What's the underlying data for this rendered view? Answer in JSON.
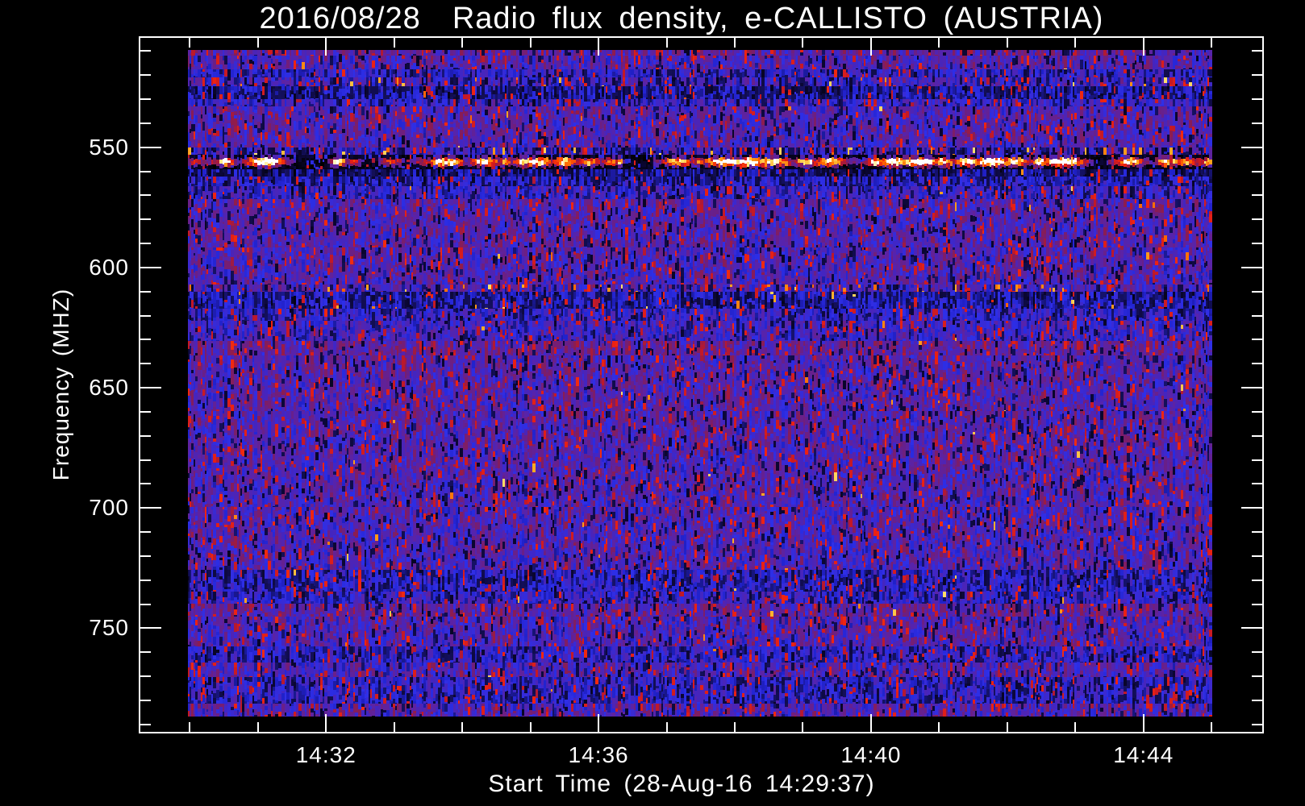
{
  "figure": {
    "title": "2016/08/28  Radio flux density, e-CALLISTO (AUSTRIA)",
    "x_axis_title": "Start Time (28-Aug-16 14:29:37)",
    "y_axis_title": "Frequency (MHZ)"
  },
  "colors": {
    "background": "#000000",
    "foreground": "#ffffff",
    "noise_violet": "#5a23a8",
    "noise_blue": "#2e2fe8",
    "noise_red": "#ee2211",
    "rfi_peak": "#ffee66"
  },
  "chart_data": {
    "type": "heatmap",
    "subtype": "radio-spectrogram",
    "title": "2016/08/28  Radio flux density, e-CALLISTO (AUSTRIA)",
    "xlabel": "Start Time (28-Aug-16 14:29:37)",
    "ylabel": "Frequency (MHZ)",
    "observation_start": "14:29:37",
    "y_axis_inverted_downward": true,
    "grid": false,
    "legend": false,
    "x_axis": {
      "frame_start": "14:29:15",
      "frame_end": "14:45:46",
      "major_ticks": [
        {
          "time": "14:32:00",
          "label": "14:32"
        },
        {
          "time": "14:36:00",
          "label": "14:36"
        },
        {
          "time": "14:40:00",
          "label": "14:40"
        },
        {
          "time": "14:44:00",
          "label": "14:44"
        }
      ],
      "minor_tick_start": "14:30:00",
      "minor_tick_end": "14:45:00",
      "minor_tick_step_seconds": 60,
      "data_start": "14:29:55",
      "data_end": "14:45:00"
    },
    "y_axis": {
      "frame_top_mhz": 503.8,
      "frame_bottom_mhz": 793.8,
      "major_ticks": [
        550,
        600,
        650,
        700,
        750
      ],
      "minor_tick_start_mhz": 510,
      "minor_tick_end_mhz": 790,
      "minor_tick_step_mhz": 10,
      "data_top_mhz": 510,
      "data_bottom_mhz": 787
    },
    "colormap_stops": [
      [
        0.0,
        "#000000"
      ],
      [
        0.08,
        "#0a0630"
      ],
      [
        0.16,
        "#14105e"
      ],
      [
        0.24,
        "#2020c8"
      ],
      [
        0.32,
        "#2e2fe8"
      ],
      [
        0.4,
        "#4325c0"
      ],
      [
        0.5,
        "#5a23a8"
      ],
      [
        0.58,
        "#6a1f86"
      ],
      [
        0.66,
        "#8c1c50"
      ],
      [
        0.72,
        "#c01828"
      ],
      [
        0.78,
        "#ee2211"
      ],
      [
        0.85,
        "#ff6600"
      ],
      [
        0.92,
        "#ffaa22"
      ],
      [
        0.97,
        "#ffe877"
      ],
      [
        1.0,
        "#ffffff"
      ]
    ],
    "spectral_features": [
      {
        "f0": 510.0,
        "f1": 512.5,
        "desc": "bright top edge rows",
        "m": 0.5,
        "s": 0.34
      },
      {
        "f0": 512.5,
        "f1": 518.0,
        "desc": "violet noise",
        "m": 0.44,
        "s": 0.38
      },
      {
        "f0": 518.0,
        "f1": 521.5,
        "desc": "faint blue row",
        "m": 0.3,
        "s": 0.3
      },
      {
        "f0": 521.5,
        "f1": 525.0,
        "desc": "dark row with orange speckles",
        "m": 0.33,
        "s": 0.46,
        "po": 0.025
      },
      {
        "f0": 525.0,
        "f1": 530.5,
        "desc": "bright blue band",
        "m": 0.21,
        "s": 0.26,
        "pr": 0.05
      },
      {
        "f0": 530.5,
        "f1": 533.5,
        "desc": "blue-violet mix",
        "m": 0.33,
        "s": 0.36
      },
      {
        "f0": 533.5,
        "f1": 550.5,
        "desc": "violet noise",
        "m": 0.45,
        "s": 0.37
      },
      {
        "f0": 550.5,
        "f1": 553.5,
        "desc": "speckled orange RFI edge row",
        "m": 0.32,
        "s": 0.5,
        "po": 0.06,
        "pd": 0.2
      },
      {
        "f0": 553.5,
        "f1": 559.5,
        "desc": "strong RFI: black band with bright orange/yellow bursts ~555-558 MHz",
        "type": "rfi"
      },
      {
        "f0": 559.5,
        "f1": 562.5,
        "desc": "bright blue band",
        "m": 0.17,
        "s": 0.22,
        "pr": 0.04
      },
      {
        "f0": 562.5,
        "f1": 566.5,
        "desc": "blue band",
        "m": 0.25,
        "s": 0.3,
        "pr": 0.05
      },
      {
        "f0": 566.5,
        "f1": 572.0,
        "desc": "blue-violet mix",
        "m": 0.33,
        "s": 0.35
      },
      {
        "f0": 572.0,
        "f1": 592.0,
        "desc": "violet noise",
        "m": 0.46,
        "s": 0.37
      },
      {
        "f0": 592.0,
        "f1": 607.5,
        "desc": "violet noise",
        "m": 0.44,
        "s": 0.38
      },
      {
        "f0": 607.5,
        "f1": 610.5,
        "desc": "orange speckled RFI row ~609 MHz",
        "m": 0.4,
        "s": 0.46,
        "po": 0.05
      },
      {
        "f0": 610.5,
        "f1": 617.5,
        "desc": "bright blue band with orange dashes",
        "m": 0.22,
        "s": 0.27,
        "pr": 0.05,
        "po": 0.015
      },
      {
        "f0": 617.5,
        "f1": 622.5,
        "desc": "blue band",
        "m": 0.31,
        "s": 0.33
      },
      {
        "f0": 622.5,
        "f1": 631.0,
        "desc": "blue-violet mix",
        "m": 0.37,
        "s": 0.36
      },
      {
        "f0": 631.0,
        "f1": 637.0,
        "desc": "lighter violet row",
        "m": 0.51,
        "s": 0.32
      },
      {
        "f0": 637.0,
        "f1": 660.0,
        "desc": "violet noise",
        "m": 0.46,
        "s": 0.37
      },
      {
        "f0": 660.0,
        "f1": 700.0,
        "desc": "violet noise",
        "m": 0.45,
        "s": 0.37
      },
      {
        "f0": 700.0,
        "f1": 726.0,
        "desc": "violet noise",
        "m": 0.44,
        "s": 0.38
      },
      {
        "f0": 726.0,
        "f1": 735.0,
        "desc": "bright blue band",
        "m": 0.27,
        "s": 0.31,
        "pr": 0.06
      },
      {
        "f0": 735.0,
        "f1": 740.0,
        "desc": "blue mix",
        "m": 0.31,
        "s": 0.34
      },
      {
        "f0": 740.0,
        "f1": 745.5,
        "desc": "lighter violet/pink row",
        "m": 0.51,
        "s": 0.33
      },
      {
        "f0": 745.5,
        "f1": 758.0,
        "desc": "violet noise",
        "m": 0.44,
        "s": 0.38
      },
      {
        "f0": 758.0,
        "f1": 764.5,
        "desc": "blue band",
        "m": 0.29,
        "s": 0.33,
        "pr": 0.06
      },
      {
        "f0": 764.5,
        "f1": 770.5,
        "desc": "violet noise",
        "m": 0.43,
        "s": 0.4
      },
      {
        "f0": 770.5,
        "f1": 781.5,
        "desc": "blue bands with red speckles",
        "m": 0.29,
        "s": 0.34,
        "pr": 0.07
      },
      {
        "f0": 781.5,
        "f1": 787.0,
        "desc": "violet/red mix bottom rows",
        "m": 0.44,
        "s": 0.42,
        "pr": 0.09
      }
    ],
    "rfi_band": {
      "center_mhz": 556.5,
      "halfwidth_mhz": 2.4,
      "bright_patches_x_fraction": [
        0.037,
        0.076,
        0.147,
        0.246,
        0.257,
        0.289,
        0.336,
        0.368,
        0.478,
        0.525,
        0.549,
        0.572,
        0.627,
        0.69,
        0.714,
        0.738,
        0.761,
        0.785,
        0.808,
        0.832,
        0.856,
        0.919,
        0.954
      ],
      "n_random_blobs": 60
    }
  }
}
